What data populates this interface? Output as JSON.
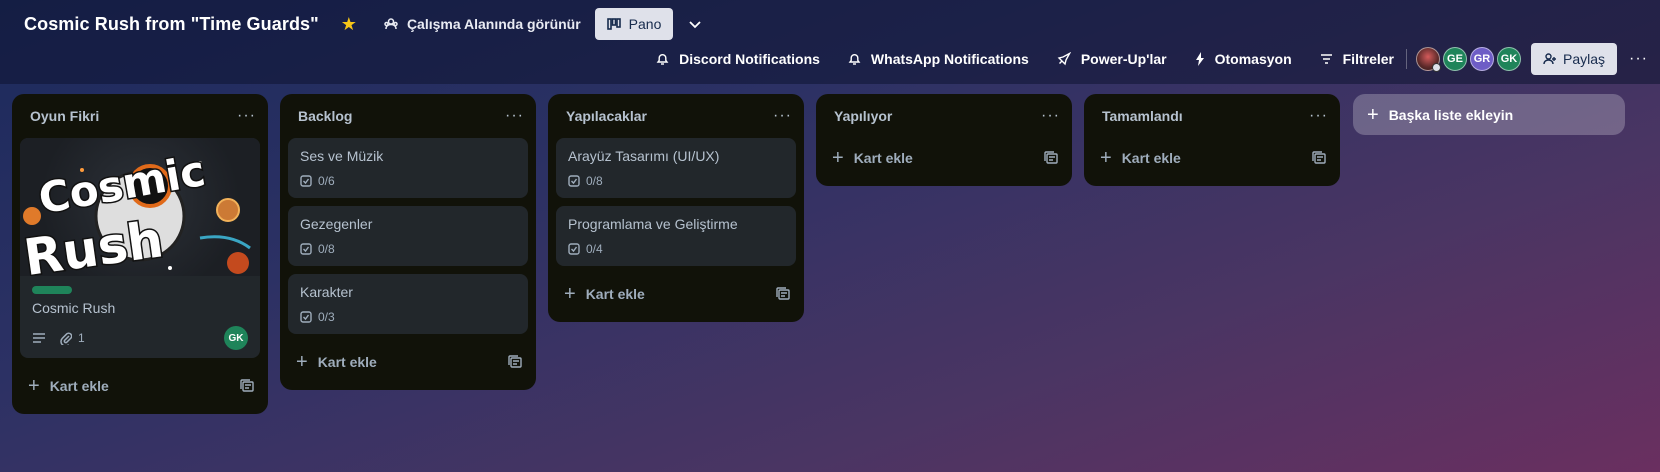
{
  "header": {
    "board_title": "Cosmic Rush from \"Time Guards\"",
    "visibility_label": "Çalışma Alanında görünür",
    "view_button_label": "Pano",
    "actions": [
      {
        "label": "Discord Notifications",
        "icon": "bell-icon"
      },
      {
        "label": "WhatsApp Notifications",
        "icon": "bell-icon"
      },
      {
        "label": "Power-Up'lar",
        "icon": "rocket-icon"
      },
      {
        "label": "Otomasyon",
        "icon": "lightning-icon"
      },
      {
        "label": "Filtreler",
        "icon": "filter-icon"
      }
    ],
    "members": [
      "GE",
      "GR",
      "GK"
    ],
    "share_label": "Paylaş",
    "more": "···"
  },
  "colors": {
    "star": "#f5c518",
    "label_green": "#1f845a",
    "avatar_ge": "#1f845a",
    "avatar_gr": "#6e5dc6",
    "avatar_gk": "#1f845a"
  },
  "lists": [
    {
      "title": "Oyun Fikri",
      "cards": [
        {
          "title": "Cosmic Rush",
          "attachments": "1",
          "member": "GK",
          "cover_text": [
            "Cosmic",
            "Rush"
          ]
        }
      ],
      "add_card": "Kart ekle"
    },
    {
      "title": "Backlog",
      "cards": [
        {
          "title": "Ses ve Müzik",
          "checklist": "0/6"
        },
        {
          "title": "Gezegenler",
          "checklist": "0/8"
        },
        {
          "title": "Karakter",
          "checklist": "0/3"
        }
      ],
      "add_card": "Kart ekle"
    },
    {
      "title": "Yapılacaklar",
      "cards": [
        {
          "title": "Arayüz Tasarımı (UI/UX)",
          "checklist": "0/8"
        },
        {
          "title": "Programlama ve Geliştirme",
          "checklist": "0/4"
        }
      ],
      "add_card": "Kart ekle"
    },
    {
      "title": "Yapılıyor",
      "cards": [],
      "add_card": "Kart ekle"
    },
    {
      "title": "Tamamlandı",
      "cards": [],
      "add_card": "Kart ekle"
    }
  ],
  "add_list_label": "Başka liste ekleyin",
  "list_menu": "···"
}
